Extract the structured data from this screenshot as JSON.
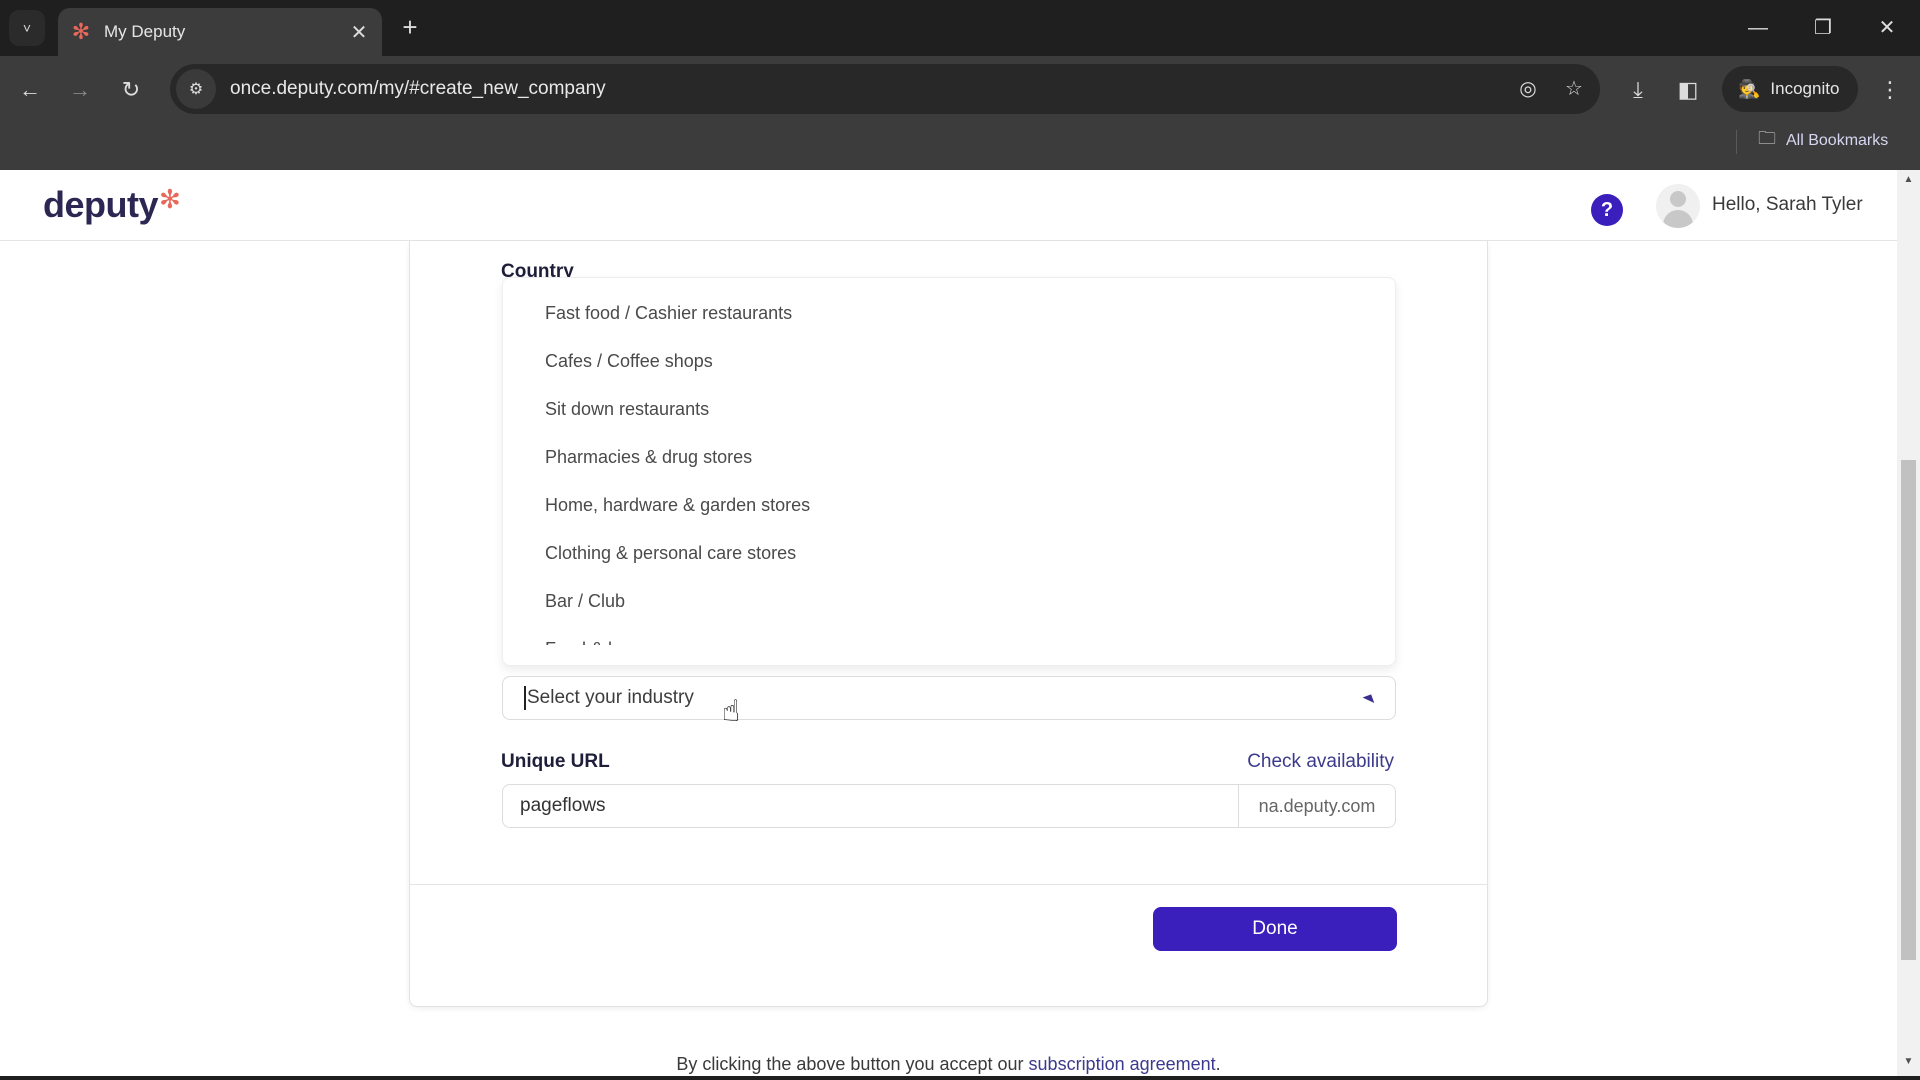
{
  "browser": {
    "tab": {
      "title": "My Deputy",
      "favicon": "deputy-logo-icon"
    },
    "url": "once.deputy.com/my/#create_new_company",
    "incognito_label": "Incognito",
    "bookmarks_label": "All Bookmarks",
    "icons": {
      "tab_search": "˅",
      "close": "✕",
      "new_tab": "+",
      "back": "←",
      "forward": "→",
      "reload": "↻",
      "site_info": "⚙",
      "eye_off": "◎",
      "star": "☆",
      "download": "⤓",
      "side_panel": "◧",
      "incognito": "🕵",
      "menu": "⋮",
      "folder": "🗀",
      "minimize": "—",
      "restore": "❐",
      "window_close": "✕"
    }
  },
  "header": {
    "logo_text": "deputy",
    "logo_mark": "✻",
    "help_label": "?",
    "greeting": "Hello, Sarah Tyler"
  },
  "form": {
    "country_label": "Country",
    "industry_options": [
      "Fast food / Cashier restaurants",
      "Cafes / Coffee shops",
      "Sit down restaurants",
      "Pharmacies & drug stores",
      "Home, hardware & garden stores",
      "Clothing & personal care stores",
      "Bar / Club",
      "Food & beverage"
    ],
    "industry_placeholder": "Select your industry",
    "industry_arrow": "◥",
    "unique_url_label": "Unique URL",
    "check_availability": "Check availability",
    "url_value": "pageflows",
    "url_suffix": "na.deputy.com",
    "done_label": "Done"
  },
  "footer": {
    "prefix": "By clicking the above button you accept our ",
    "link": "subscription agreement",
    "suffix": "."
  },
  "scrollbar": {
    "up": "▲",
    "down": "▼"
  },
  "colors": {
    "brand_primary": "#3a1fbd",
    "brand_accent": "#e8685b",
    "link": "#3c3a8c"
  }
}
